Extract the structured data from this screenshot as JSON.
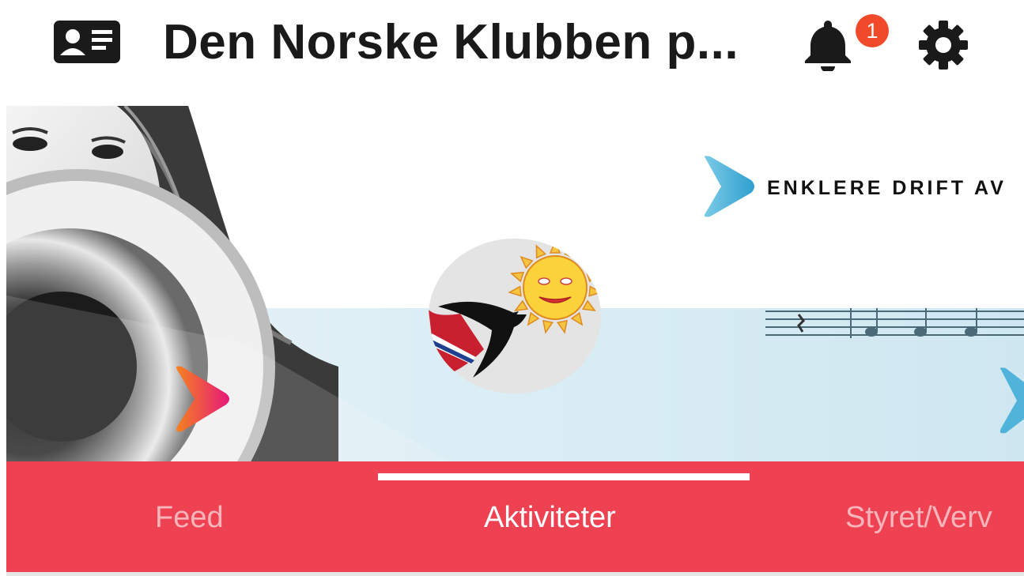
{
  "header": {
    "title": "Den Norske Klubben p...",
    "notification_count": "1",
    "icons": [
      "member-card-icon",
      "bell-icon",
      "gear-icon"
    ]
  },
  "banner": {
    "slogan": "ENKLERE DRIFT AV"
  },
  "tabs": [
    {
      "label": "Feed",
      "selected": false
    },
    {
      "label": "Aktiviteter",
      "selected": true
    },
    {
      "label": "Styret/Verv",
      "selected": false
    }
  ],
  "colors": {
    "tab_bar": "#ee4152",
    "badge": "#f04a2a",
    "arrow_blue": "#3ab0d8",
    "arrow_orange": "#f26a2e"
  }
}
